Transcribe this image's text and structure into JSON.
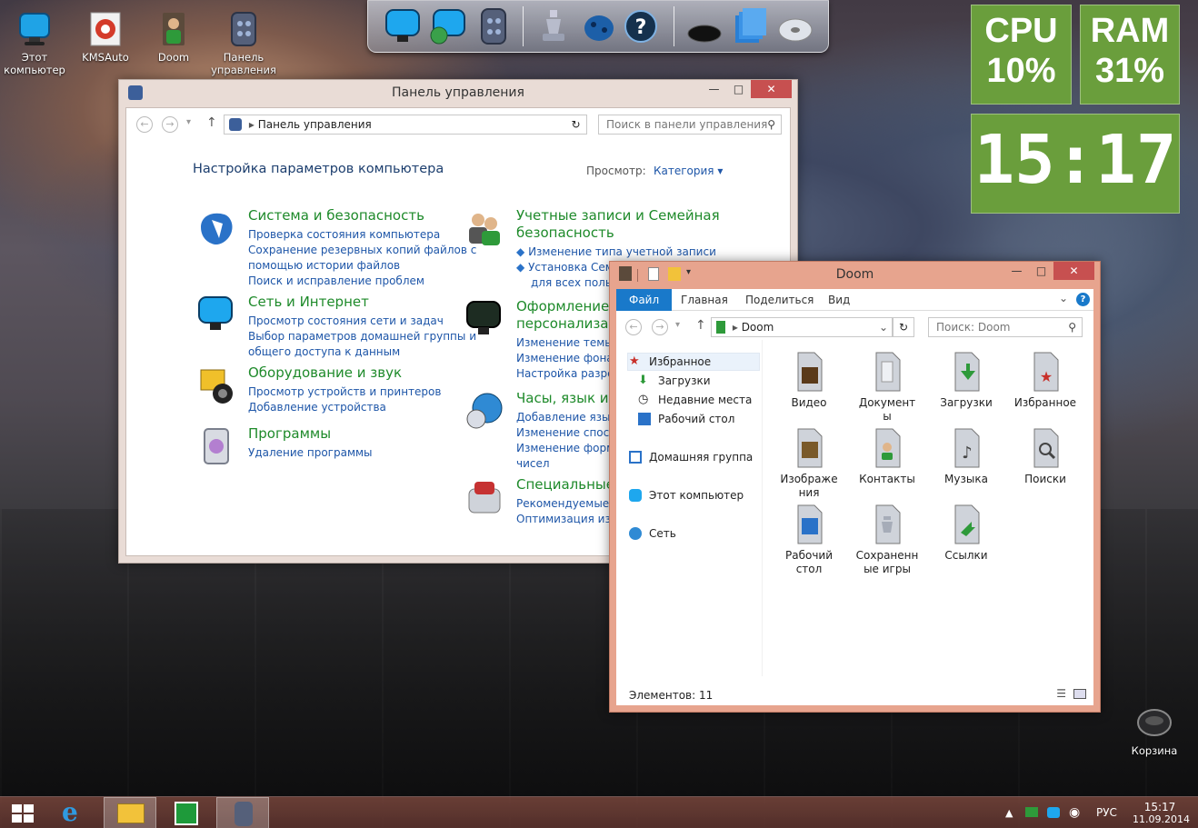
{
  "desktop": {
    "icons": [
      {
        "label": "Этот компьютер"
      },
      {
        "label": "KMSAuto"
      },
      {
        "label": "Doom"
      },
      {
        "label": "Панель управления"
      }
    ],
    "recycle_bin": {
      "label": "Корзина"
    }
  },
  "widgets": {
    "cpu": {
      "label": "CPU",
      "value": "10%"
    },
    "ram": {
      "label": "RAM",
      "value": "31%"
    },
    "clock": {
      "time": "15:17"
    },
    "accent": "#6a9e3c"
  },
  "control_panel": {
    "title": "Панель управления",
    "address": "Панель управления",
    "search_placeholder": "Поиск в панели управления",
    "heading": "Настройка параметров компьютера",
    "view_label": "Просмотр:",
    "view_value": "Категория",
    "categories_left": [
      {
        "title": "Система и безопасность",
        "icon": "shield-icon",
        "links": [
          "Проверка состояния компьютера",
          "Сохранение резервных копий файлов с",
          "помощью истории файлов",
          "Поиск и исправление проблем"
        ]
      },
      {
        "title": "Сеть и Интернет",
        "icon": "network-icon",
        "links": [
          "Просмотр состояния сети и задач",
          "Выбор параметров домашней группы и",
          "общего доступа к данным"
        ]
      },
      {
        "title": "Оборудование и звук",
        "icon": "hardware-sound-icon",
        "links": [
          "Просмотр устройств и принтеров",
          "Добавление устройства"
        ]
      },
      {
        "title": "Программы",
        "icon": "programs-icon",
        "links": [
          "Удаление программы"
        ]
      }
    ],
    "categories_right": [
      {
        "title": "Учетные записи и Семейная",
        "title2": "безопасность",
        "icon": "users-icon",
        "links": [
          "Изменение типа учетной записи",
          "Установка Семе",
          "для всех пользо"
        ]
      },
      {
        "title": "Оформление и",
        "title2": "персонализаци",
        "icon": "monitor-icon",
        "links": [
          "Изменение темы",
          "Изменение фона р",
          "Настройка разреш"
        ]
      },
      {
        "title": "Часы, язык и р",
        "icon": "globe-clock-icon",
        "links": [
          "Добавление языка",
          "Изменение способ",
          "Изменение формат",
          "чисел"
        ]
      },
      {
        "title": "Специальные в",
        "icon": "accessibility-icon",
        "links": [
          "Рекомендуемые W",
          "Оптимизация изоб"
        ]
      }
    ]
  },
  "explorer": {
    "title": "Doom",
    "ribbon_tabs": [
      "Файл",
      "Главная",
      "Поделиться",
      "Вид"
    ],
    "address": "Doom",
    "search_placeholder": "Поиск: Doom",
    "nav": [
      {
        "label": "Избранное"
      },
      {
        "label": "Загрузки"
      },
      {
        "label": "Недавние места"
      },
      {
        "label": "Рабочий стол"
      },
      {
        "label": "Домашняя группа"
      },
      {
        "label": "Этот компьютер"
      },
      {
        "label": "Сеть"
      }
    ],
    "items": [
      {
        "line1": "Видео",
        "line2": ""
      },
      {
        "line1": "Документ",
        "line2": "ы"
      },
      {
        "line1": "Загрузки",
        "line2": ""
      },
      {
        "line1": "Избранное",
        "line2": ""
      },
      {
        "line1": "Изображе",
        "line2": "ния"
      },
      {
        "line1": "Контакты",
        "line2": ""
      },
      {
        "line1": "Музыка",
        "line2": ""
      },
      {
        "line1": "Поиски",
        "line2": ""
      },
      {
        "line1": "Рабочий",
        "line2": "стол"
      },
      {
        "line1": "Сохраненн",
        "line2": "ые игры"
      },
      {
        "line1": "Ссылки",
        "line2": ""
      }
    ],
    "status": "Элементов: 11"
  },
  "taskbar": {
    "language": "РУС",
    "time": "15:17",
    "date": "11.09.2014"
  }
}
